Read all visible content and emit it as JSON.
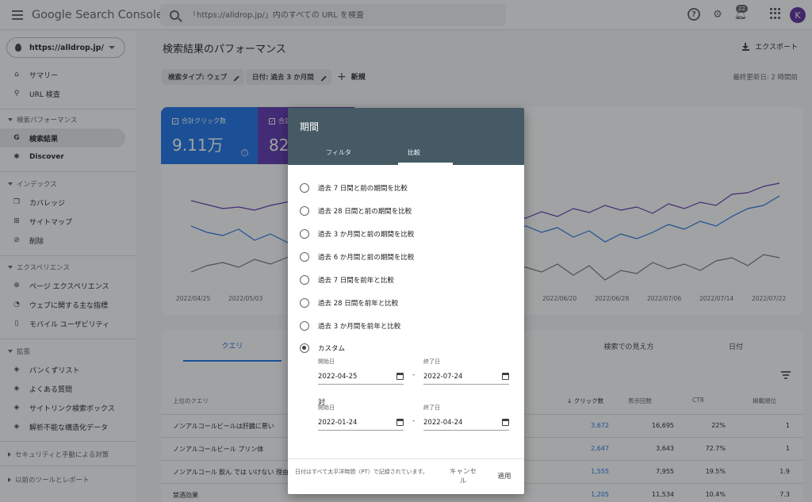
{
  "header": {
    "product_google": "Google",
    "product_name": "Search Console",
    "search_placeholder": "「https://alldrop.jp/」内のすべての URL を検査",
    "notification_count": "22",
    "avatar_letter": "K"
  },
  "sidebar": {
    "property": "https://alldrop.jp/",
    "summary": "サマリー",
    "url_inspection": "URL 検査",
    "section_performance": "検索パフォーマンス",
    "search_results": "検索結果",
    "discover": "Discover",
    "section_index": "インデックス",
    "coverage": "カバレッジ",
    "sitemaps": "サイトマップ",
    "removals": "削除",
    "section_experience": "エクスペリエンス",
    "page_experience": "ページ エクスペリエンス",
    "web_vitals": "ウェブに関する主な指標",
    "mobile_usability": "モバイル ユーザビリティ",
    "section_enhancements": "拡張",
    "breadcrumbs": "パンくずリスト",
    "faq": "よくある質問",
    "sitelinks": "サイトリンク検索ボックス",
    "unparsable": "解析不能な構造化データ",
    "security": "セキュリティと手動による対策",
    "legacy": "以前のツールとレポート"
  },
  "main": {
    "title": "検索結果のパフォーマンス",
    "export": "エクスポート",
    "chip_search_type": "検索タイプ: ウェブ",
    "chip_date": "日付: 過去 3 か月間",
    "new": "新規",
    "updated": "最終更新日: 2 時間前"
  },
  "metrics": {
    "clicks_label": "合計クリック数",
    "clicks_value": "9.11万",
    "impressions_label": "合計表",
    "impressions_value": "82万",
    "clicks_color": "#1a73e8",
    "impressions_color": "#5e35b1"
  },
  "chart_data": {
    "type": "line",
    "x_ticks_left": [
      "2022/04/25",
      "2022/05/03"
    ],
    "x_ticks_right": [
      "2022/06/20",
      "2022/06/28",
      "2022/07/06",
      "2022/07/14",
      "2022/07/22"
    ]
  },
  "table": {
    "tabs": [
      "クエリ",
      "検索での見え方",
      "日付"
    ],
    "col_query": "上位のクエリ",
    "col_clicks": "クリック数",
    "col_impressions": "表示回数",
    "col_ctr": "CTR",
    "col_position": "掲載順位",
    "rows": [
      {
        "query": "ノンアルコールビールは肝臓に悪い",
        "clicks": "3,672",
        "impressions": "16,695",
        "ctr": "22%",
        "position": "1"
      },
      {
        "query": "ノンアルコールビール プリン体",
        "clicks": "2,647",
        "impressions": "3,643",
        "ctr": "72.7%",
        "position": "1"
      },
      {
        "query": "ノンアルコール 飲ん では いけない 理由",
        "clicks": "1,555",
        "impressions": "7,955",
        "ctr": "19.5%",
        "position": "1.9"
      },
      {
        "query": "禁酒効果",
        "clicks": "1,205",
        "impressions": "11,534",
        "ctr": "10.4%",
        "position": "7.3"
      }
    ]
  },
  "dialog": {
    "title": "期間",
    "tab_filter": "フィルタ",
    "tab_compare": "比較",
    "options": [
      "過去 7 日間と前の期間を比較",
      "過去 28 日間と前の期間を比較",
      "過去 3 か月間と前の期間を比較",
      "過去 6 か月間と前の期間を比較",
      "過去 7 日間を前年と比較",
      "過去 28 日間を前年と比較",
      "過去 3 か月間を前年と比較",
      "カスタム"
    ],
    "start_label": "開始日",
    "end_label": "終了日",
    "range1_start": "2022-04-25",
    "range1_end": "2022-07-24",
    "versus": "対",
    "range2_start": "2022-01-24",
    "range2_end": "2022-04-24",
    "dash": "-",
    "note": "日付はすべて太平洋時間（PT）で記録されています。",
    "cancel": "キャンセル",
    "apply": "適用"
  }
}
